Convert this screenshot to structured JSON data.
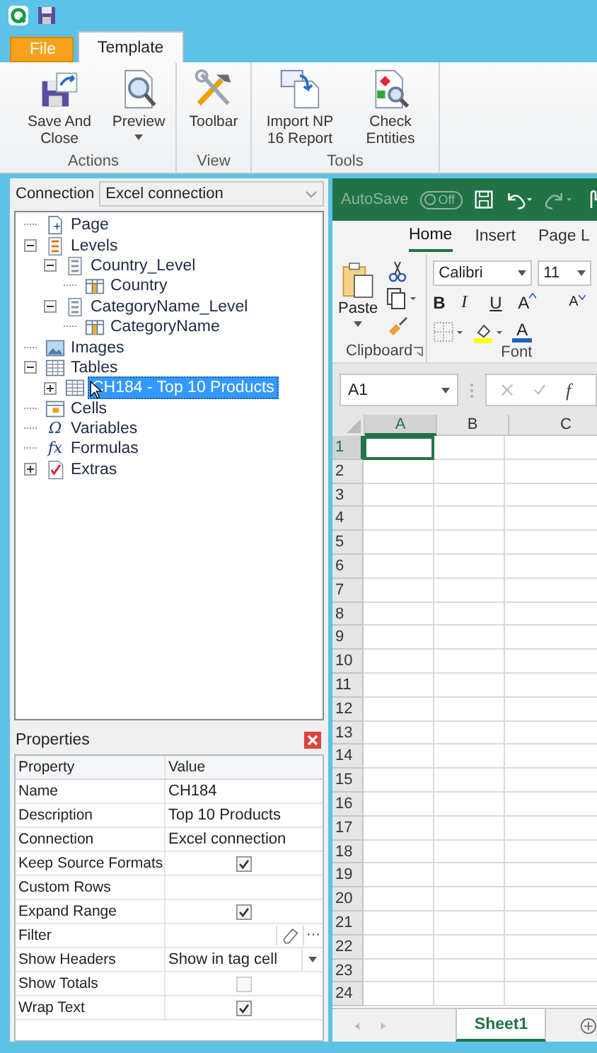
{
  "ribbon_tabs": [
    {
      "label": "File",
      "kind": "file",
      "selected": false
    },
    {
      "label": "Template",
      "kind": "tab",
      "selected": true
    }
  ],
  "ribbon_groups": [
    {
      "label": "Actions",
      "buttons": [
        {
          "label": "Save And Close",
          "kind": "save"
        },
        {
          "label": "Preview",
          "kind": "preview",
          "dropdown": true
        }
      ]
    },
    {
      "label": "View",
      "buttons": [
        {
          "label": "Toolbar",
          "kind": "toolbar"
        }
      ]
    },
    {
      "label": "Tools",
      "buttons": [
        {
          "label": "Import NP 16 Report",
          "kind": "import"
        },
        {
          "label": "Check Entities",
          "kind": "check"
        }
      ]
    }
  ],
  "connection": {
    "label": "Connection",
    "value": "Excel connection"
  },
  "tree": [
    {
      "label": "Page",
      "kind": "page",
      "selected": false
    },
    {
      "label": "Levels",
      "kind": "levels",
      "expanded": true,
      "selected": false,
      "children": [
        {
          "label": "Country_Level",
          "kind": "level",
          "expanded": true,
          "selected": false,
          "children": [
            {
              "label": "Country",
              "kind": "fields",
              "selected": false
            }
          ]
        },
        {
          "label": "CategoryName_Level",
          "kind": "level",
          "expanded": true,
          "selected": false,
          "children": [
            {
              "label": "CategoryName",
              "kind": "fields",
              "selected": false
            }
          ]
        }
      ]
    },
    {
      "label": "Images",
      "kind": "images",
      "selected": false
    },
    {
      "label": "Tables",
      "kind": "tables",
      "expanded": true,
      "selected": false,
      "children": [
        {
          "label": "CH184 - Top 10 Products",
          "kind": "table",
          "expanded": false,
          "selected": true
        }
      ]
    },
    {
      "label": "Cells",
      "kind": "cells",
      "selected": false
    },
    {
      "label": "Variables",
      "kind": "glyph",
      "glyph": "Ω",
      "selected": false
    },
    {
      "label": "Formulas",
      "kind": "glyph",
      "glyph": "fx",
      "selected": false
    },
    {
      "label": "Extras",
      "kind": "extras",
      "expanded": false,
      "selected": false
    }
  ],
  "properties": {
    "title": "Properties",
    "columns": [
      "Property",
      "Value"
    ],
    "rows": [
      {
        "name": "Name",
        "kind": "text",
        "value": "CH184"
      },
      {
        "name": "Description",
        "kind": "text",
        "value": "Top 10 Products"
      },
      {
        "name": "Connection",
        "kind": "text",
        "value": "Excel connection"
      },
      {
        "name": "Keep Source Formats",
        "kind": "check",
        "checked": true
      },
      {
        "name": "Custom Rows",
        "kind": "text"
      },
      {
        "name": "Expand Range",
        "kind": "check",
        "checked": true
      },
      {
        "name": "Filter",
        "kind": "filter",
        "more": "···"
      },
      {
        "name": "Show Headers",
        "kind": "dropdown",
        "value": "Show in tag cell"
      },
      {
        "name": "Show Totals",
        "kind": "check",
        "checked": false
      },
      {
        "name": "Wrap Text",
        "kind": "check",
        "checked": true
      }
    ]
  },
  "excel": {
    "autosave": {
      "label": "AutoSave",
      "state": "Off",
      "on": false
    },
    "tabs": [
      {
        "label": "Home",
        "selected": true
      },
      {
        "label": "Insert",
        "selected": false
      },
      {
        "label": "Page L",
        "selected": false
      }
    ],
    "clipboard": {
      "paste": "Paste",
      "label": "Clipboard"
    },
    "font": {
      "name": "Calibri",
      "size": "11",
      "label": "Font",
      "buttons": [
        {
          "label": "B",
          "kind": "bold"
        },
        {
          "label": "I",
          "kind": "italic"
        },
        {
          "label": "U",
          "kind": "underline"
        },
        {
          "label": "A",
          "kind": "grow"
        },
        {
          "label": "A",
          "kind": "shrink"
        }
      ],
      "font_color": "A"
    },
    "name_box": "A1",
    "formula_label": "f",
    "columns": [
      {
        "label": "A",
        "selected": true
      },
      {
        "label": "B",
        "selected": false
      },
      {
        "label": "C",
        "selected": false
      }
    ],
    "rows": [
      {
        "label": "1",
        "selected": true
      },
      {
        "label": "2",
        "selected": false
      },
      {
        "label": "3",
        "selected": false
      },
      {
        "label": "4",
        "selected": false
      },
      {
        "label": "5",
        "selected": false
      },
      {
        "label": "6",
        "selected": false
      },
      {
        "label": "7",
        "selected": false
      },
      {
        "label": "8",
        "selected": false
      },
      {
        "label": "9",
        "selected": false
      },
      {
        "label": "10",
        "selected": false
      },
      {
        "label": "11",
        "selected": false
      },
      {
        "label": "12",
        "selected": false
      },
      {
        "label": "13",
        "selected": false
      },
      {
        "label": "14",
        "selected": false
      },
      {
        "label": "15",
        "selected": false
      },
      {
        "label": "16",
        "selected": false
      },
      {
        "label": "17",
        "selected": false
      },
      {
        "label": "18",
        "selected": false
      },
      {
        "label": "19",
        "selected": false
      },
      {
        "label": "20",
        "selected": false
      },
      {
        "label": "21",
        "selected": false
      },
      {
        "label": "22",
        "selected": false
      },
      {
        "label": "23",
        "selected": false
      },
      {
        "label": "24",
        "selected": false
      }
    ],
    "sheets": [
      {
        "label": "Sheet1",
        "selected": true
      }
    ]
  }
}
